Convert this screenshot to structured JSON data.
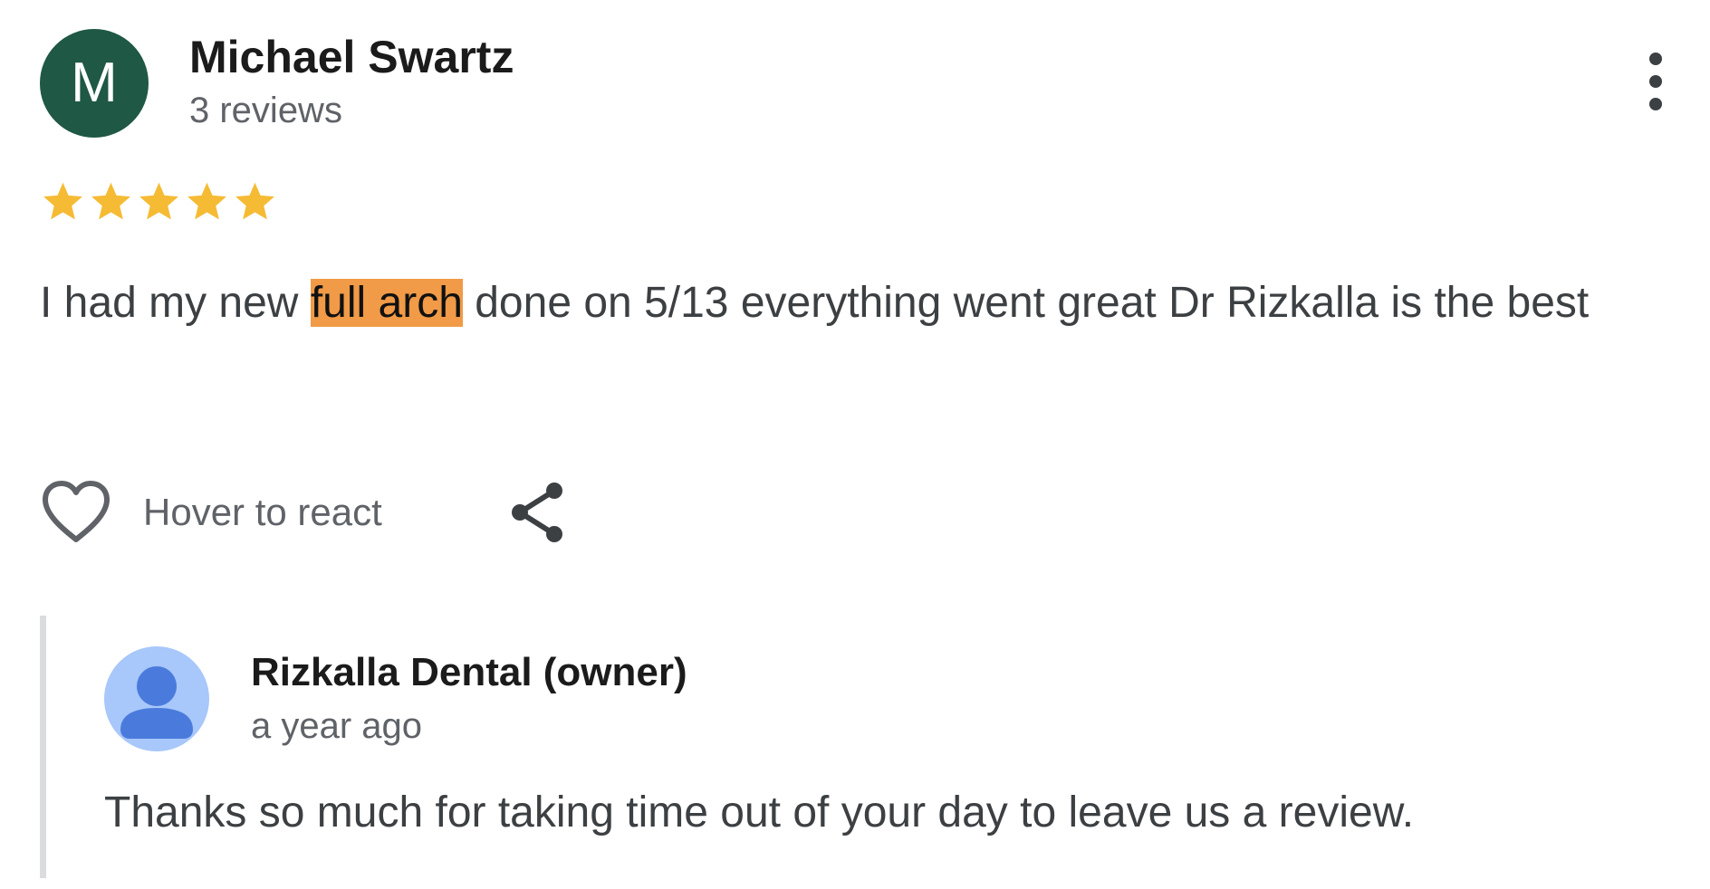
{
  "review": {
    "reviewer": {
      "initial": "M",
      "name": "Michael Swartz",
      "review_count": "3 reviews",
      "avatar_color": "#1f5845"
    },
    "rating": 5,
    "max_rating": 5,
    "star_color": "#f6bb34",
    "text": {
      "before_highlight": "I had my new ",
      "highlight": "full arch",
      "after_highlight": " done on 5/13 everything went great Dr Rizkalla is the best",
      "highlight_color": "#f19a47"
    },
    "actions": {
      "like_icon": "heart-outline-icon",
      "react_label": "Hover to react",
      "share_icon": "share-icon",
      "more_icon": "more-vert-icon"
    }
  },
  "owner_reply": {
    "name": "Rizkalla Dental (owner)",
    "time": "a year ago",
    "text": "Thanks so much for taking time out of your day to leave us a review.",
    "avatar_icon": "person-icon"
  }
}
